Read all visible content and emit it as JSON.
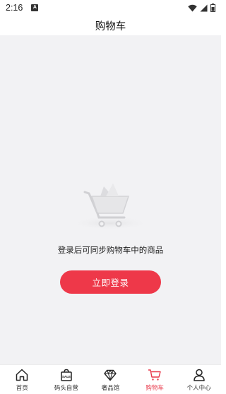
{
  "status_bar": {
    "time": "2:16",
    "notification_badge": "A"
  },
  "header": {
    "title": "购物车"
  },
  "empty_state": {
    "message": "登录后可同步购物车中的商品",
    "login_button": "立即登录"
  },
  "tabbar": {
    "items": [
      {
        "label": "首页",
        "icon": "home-icon"
      },
      {
        "label": "码头自营",
        "icon": "sale-bag-icon",
        "icon_text": "SALE"
      },
      {
        "label": "奢品馆",
        "icon": "diamond-icon"
      },
      {
        "label": "购物车",
        "icon": "cart-icon",
        "active": true
      },
      {
        "label": "个人中心",
        "icon": "user-icon"
      }
    ],
    "active_color": "#e8384a"
  },
  "colors": {
    "accent": "#ee3849",
    "background": "#f2f2f4"
  }
}
